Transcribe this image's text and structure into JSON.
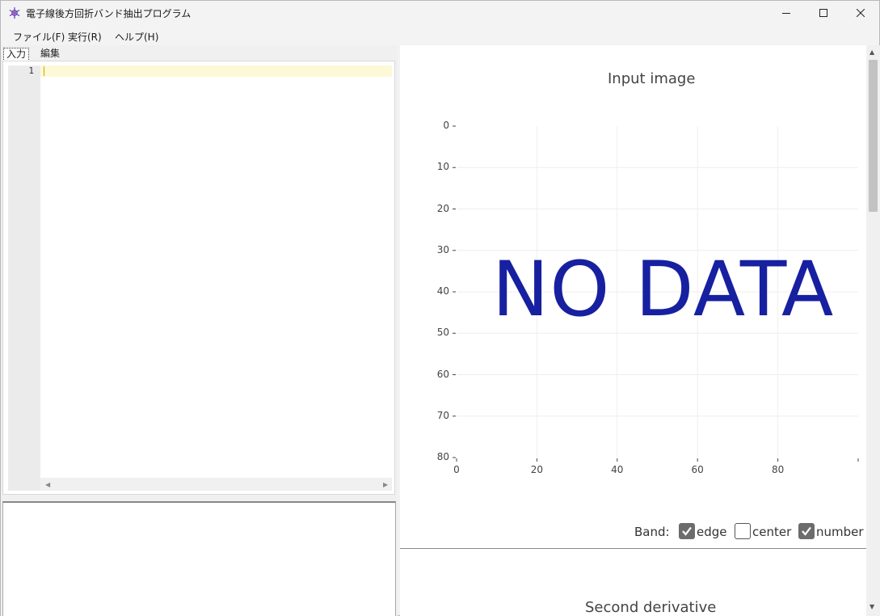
{
  "window": {
    "title": "電子線後方回折バンド抽出プログラム",
    "app_icon": "snowflake-gear-icon",
    "controls": [
      "minimize-icon",
      "maximize-icon",
      "close-icon"
    ]
  },
  "menu": [
    {
      "label": "ファイル(F)"
    },
    {
      "label": "実行(R)"
    },
    {
      "label": "ヘルプ(H)"
    }
  ],
  "tabs": [
    {
      "label": "入力",
      "selected": true
    },
    {
      "label": "編集",
      "selected": false
    }
  ],
  "editor": {
    "line_numbers": [
      "1"
    ],
    "content": ""
  },
  "plot1": {
    "title": "Input image",
    "message": "NO DATA",
    "chart_data": {
      "type": "heatmap",
      "title": "Input image",
      "x_ticks": [
        "0",
        "20",
        "40",
        "60",
        "80"
      ],
      "y_ticks": [
        "0",
        "10",
        "20",
        "30",
        "40",
        "50",
        "60",
        "70",
        "80"
      ],
      "xlim": [
        0,
        100
      ],
      "ylim": [
        80,
        0
      ],
      "grid": true,
      "values": []
    }
  },
  "band": {
    "label": "Band:",
    "options": [
      {
        "label": "edge",
        "checked": true
      },
      {
        "label": "center",
        "checked": false
      },
      {
        "label": "number",
        "checked": true
      }
    ]
  },
  "plot2": {
    "title": "Second derivative"
  },
  "colors": {
    "nodata": "#1720a0",
    "active_line": "#fdf8d6",
    "checkbox_checked": "#6c6c6c"
  }
}
